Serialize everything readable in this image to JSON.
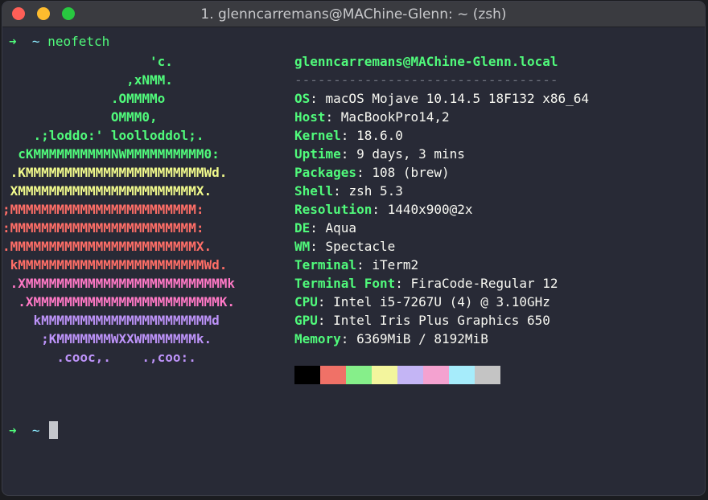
{
  "window": {
    "title": "1. glenncarremans@MAChine-Glenn: ~ (zsh)"
  },
  "prompt": {
    "arrow": "➜",
    "dir": "~",
    "command": "neofetch"
  },
  "logo": [
    {
      "text": "                   'c.",
      "color": "#50fa7b"
    },
    {
      "text": "                ,xNMM.",
      "color": "#50fa7b"
    },
    {
      "text": "              .OMMMMo",
      "color": "#50fa7b"
    },
    {
      "text": "              OMMM0,",
      "color": "#50fa7b"
    },
    {
      "text": "    .;loddo:' loolloddol;.",
      "color": "#50fa7b"
    },
    {
      "text": "  cKMMMMMMMMMMNWMMMMMMMMMM0:",
      "color": "#50fa7b"
    },
    {
      "text": " .KMMMMMMMMMMMMMMMMMMMMMMMWd.",
      "color": "#f1fa8c"
    },
    {
      "text": " XMMMMMMMMMMMMMMMMMMMMMMMX.",
      "color": "#f1fa8c"
    },
    {
      "text": ";MMMMMMMMMMMMMMMMMMMMMMMM:",
      "color": "#ff6e67"
    },
    {
      "text": ":MMMMMMMMMMMMMMMMMMMMMMMM:",
      "color": "#ff6e67"
    },
    {
      "text": ".MMMMMMMMMMMMMMMMMMMMMMMMX.",
      "color": "#ff6e67"
    },
    {
      "text": " kMMMMMMMMMMMMMMMMMMMMMMMMWd.",
      "color": "#ff6e67"
    },
    {
      "text": " .XMMMMMMMMMMMMMMMMMMMMMMMMMMk",
      "color": "#ff79c6"
    },
    {
      "text": "  .XMMMMMMMMMMMMMMMMMMMMMMMMK.",
      "color": "#ff79c6"
    },
    {
      "text": "    kMMMMMMMMMMMMMMMMMMMMMMd",
      "color": "#bd93f9"
    },
    {
      "text": "     ;KMMMMMMMWXXWMMMMMMMk.",
      "color": "#bd93f9"
    },
    {
      "text": "       .cooc,.    .,coo:.",
      "color": "#bd93f9"
    }
  ],
  "info": {
    "header": "glenncarremans@MAChine-Glenn.local",
    "separator": "----------------------------------",
    "rows": [
      {
        "key": "OS",
        "value": "macOS Mojave 10.14.5 18F132 x86_64"
      },
      {
        "key": "Host",
        "value": "MacBookPro14,2"
      },
      {
        "key": "Kernel",
        "value": "18.6.0"
      },
      {
        "key": "Uptime",
        "value": "9 days, 3 mins"
      },
      {
        "key": "Packages",
        "value": "108 (brew)"
      },
      {
        "key": "Shell",
        "value": "zsh 5.3"
      },
      {
        "key": "Resolution",
        "value": "1440x900@2x"
      },
      {
        "key": "DE",
        "value": "Aqua"
      },
      {
        "key": "WM",
        "value": "Spectacle"
      },
      {
        "key": "Terminal",
        "value": "iTerm2"
      },
      {
        "key": "Terminal Font",
        "value": "FiraCode-Regular 12"
      },
      {
        "key": "CPU",
        "value": "Intel i5-7267U (4) @ 3.10GHz"
      },
      {
        "key": "GPU",
        "value": "Intel Iris Plus Graphics 650"
      },
      {
        "key": "Memory",
        "value": "6369MiB / 8192MiB"
      }
    ]
  },
  "palette": [
    "#000000",
    "#f07167",
    "#86ef8a",
    "#f3f59d",
    "#c4b5f5",
    "#f4a2d0",
    "#a6ecfb",
    "#c4c4c4"
  ],
  "prompt2": {
    "arrow": "➜",
    "dir": "~"
  }
}
